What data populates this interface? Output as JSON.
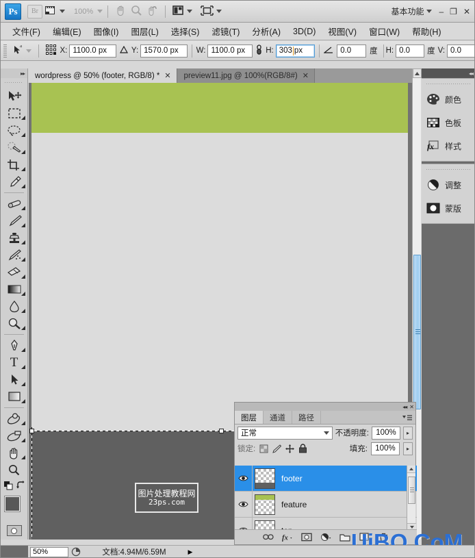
{
  "app": {
    "logo_text": "Ps",
    "bridge_label": "Br",
    "zoom_level": "100%",
    "workspace_label": "基本功能",
    "window_minimize": "–",
    "window_maximize": "❐",
    "window_close": "✕",
    "icons": {
      "view_extras": "view-extras-icon",
      "hand": "hand-tool-icon",
      "zoom": "zoom-tool-icon",
      "rotate_view": "rotate-view-icon",
      "arrange_documents": "arrange-documents-icon",
      "screen_mode": "screen-mode-icon"
    }
  },
  "menubar": {
    "items": [
      {
        "label": "文件(F)"
      },
      {
        "label": "编辑(E)"
      },
      {
        "label": "图像(I)"
      },
      {
        "label": "图层(L)"
      },
      {
        "label": "选择(S)"
      },
      {
        "label": "滤镜(T)"
      },
      {
        "label": "分析(A)"
      },
      {
        "label": "3D(D)"
      },
      {
        "label": "视图(V)"
      },
      {
        "label": "窗口(W)"
      },
      {
        "label": "帮助(H)"
      }
    ]
  },
  "options_bar": {
    "tool_icon": "move-tool-icon",
    "ref_point_icon": "reference-point-grid-icon",
    "x_label": "X:",
    "x_value": "1100.0 px",
    "delta_icon": "delta-triangle-icon",
    "y_label": "Y:",
    "y_value": "1570.0 px",
    "w_label": "W:",
    "w_value": "1100.0 px",
    "link_icon": "link-chain-icon",
    "h_label": "H:",
    "h_value": "303",
    "h_unit": "px",
    "angle_icon": "angle-icon",
    "angle_value": "0.0",
    "angle_unit": "度",
    "skew_h_label": "H:",
    "skew_h_value": "0.0",
    "skew_h_unit": "度",
    "skew_v_label": "V:",
    "skew_v_value": "0.0"
  },
  "tabs": [
    {
      "label": "wordpress @ 50% (footer, RGB/8) *",
      "close": "✕",
      "active": true
    },
    {
      "label": "preview11.jpg @ 100%(RGB/8#)",
      "close": "✕",
      "active": false
    }
  ],
  "toolbox": {
    "collapse_icon": "expand-arrows-icon",
    "tools": [
      {
        "name": "move-tool",
        "glyph": "move"
      },
      {
        "name": "rectangular-marquee-tool",
        "glyph": "marquee"
      },
      {
        "name": "lasso-tool",
        "glyph": "lasso"
      },
      {
        "name": "quick-selection-tool",
        "glyph": "quickselect"
      },
      {
        "name": "crop-tool",
        "glyph": "crop"
      },
      {
        "name": "eyedropper-tool",
        "glyph": "eyedropper"
      },
      {
        "name": "spot-healing-brush-tool",
        "glyph": "heal"
      },
      {
        "name": "brush-tool",
        "glyph": "brush"
      },
      {
        "name": "clone-stamp-tool",
        "glyph": "stamp"
      },
      {
        "name": "history-brush-tool",
        "glyph": "historybrush"
      },
      {
        "name": "eraser-tool",
        "glyph": "eraser"
      },
      {
        "name": "gradient-tool",
        "glyph": "gradient"
      },
      {
        "name": "blur-tool",
        "glyph": "blur"
      },
      {
        "name": "dodge-tool",
        "glyph": "dodge"
      },
      {
        "name": "pen-tool",
        "glyph": "pen"
      },
      {
        "name": "horizontal-type-tool",
        "glyph": "type"
      },
      {
        "name": "path-selection-tool",
        "glyph": "pathselect"
      },
      {
        "name": "rectangle-tool",
        "glyph": "shape"
      },
      {
        "name": "3d-rotate-tool",
        "glyph": "rotate3d"
      },
      {
        "name": "3d-orbit-tool",
        "glyph": "orbit3d"
      },
      {
        "name": "hand-tool",
        "glyph": "hand"
      },
      {
        "name": "zoom-tool",
        "glyph": "zoom"
      }
    ],
    "foreground_color": "#585858",
    "background_color": "#d0d0d0",
    "quickmask_name": "quick-mask-toggle"
  },
  "canvas": {
    "band_green_color": "#a8c252",
    "band_body_color": "#dcdcdc",
    "band_footer_color": "#606060",
    "watermark": {
      "line1": "图片处理教程网",
      "line2": "23ps.com"
    }
  },
  "right_dock": {
    "collapse_icon": "collapse-dock-icon",
    "groups": [
      {
        "items": [
          {
            "label": "颜色",
            "icon": "color-palette-icon"
          },
          {
            "label": "色板",
            "icon": "swatches-grid-icon"
          },
          {
            "label": "样式",
            "icon": "styles-fx-icon"
          }
        ]
      },
      {
        "items": [
          {
            "label": "调整",
            "icon": "adjustments-halfcircle-icon"
          },
          {
            "label": "蒙版",
            "icon": "masks-circle-icon"
          }
        ]
      }
    ]
  },
  "layers_panel": {
    "collapse_icon": "collapse-panel-icon",
    "close_icon": "close-panel-icon",
    "menu_icon": "panel-menu-icon",
    "tabs": [
      {
        "label": "图层",
        "active": true
      },
      {
        "label": "通道",
        "active": false
      },
      {
        "label": "路径",
        "active": false
      }
    ],
    "blend_mode": "正常",
    "opacity_label": "不透明度:",
    "opacity_value": "100%",
    "lock_label": "锁定:",
    "lock_icons": [
      "lock-transparent-pixels-icon",
      "lock-image-pixels-icon",
      "lock-position-icon",
      "lock-all-icon"
    ],
    "fill_label": "填充:",
    "fill_value": "100%",
    "layers": [
      {
        "name": "footer",
        "selected": true,
        "visible": true,
        "thumb": "footer-thumb"
      },
      {
        "name": "feature",
        "selected": false,
        "visible": true,
        "thumb": "feature-thumb"
      },
      {
        "name": "top",
        "selected": false,
        "visible": true,
        "thumb": "top-thumb"
      }
    ],
    "footer_buttons": [
      "link-layers-icon",
      "add-layer-style-icon",
      "add-layer-mask-icon",
      "new-adjustment-layer-icon",
      "new-group-icon",
      "new-layer-icon",
      "delete-layer-icon"
    ]
  },
  "status_bar": {
    "zoom_value": "50%",
    "preview_icon": "preview-proxy-icon",
    "doc_info": "文档:4.94M/6.59M",
    "expand_arrow": "▶"
  },
  "overlay_watermark": {
    "text": "UiBQ.CoM",
    "color": "#2b6fd4"
  }
}
